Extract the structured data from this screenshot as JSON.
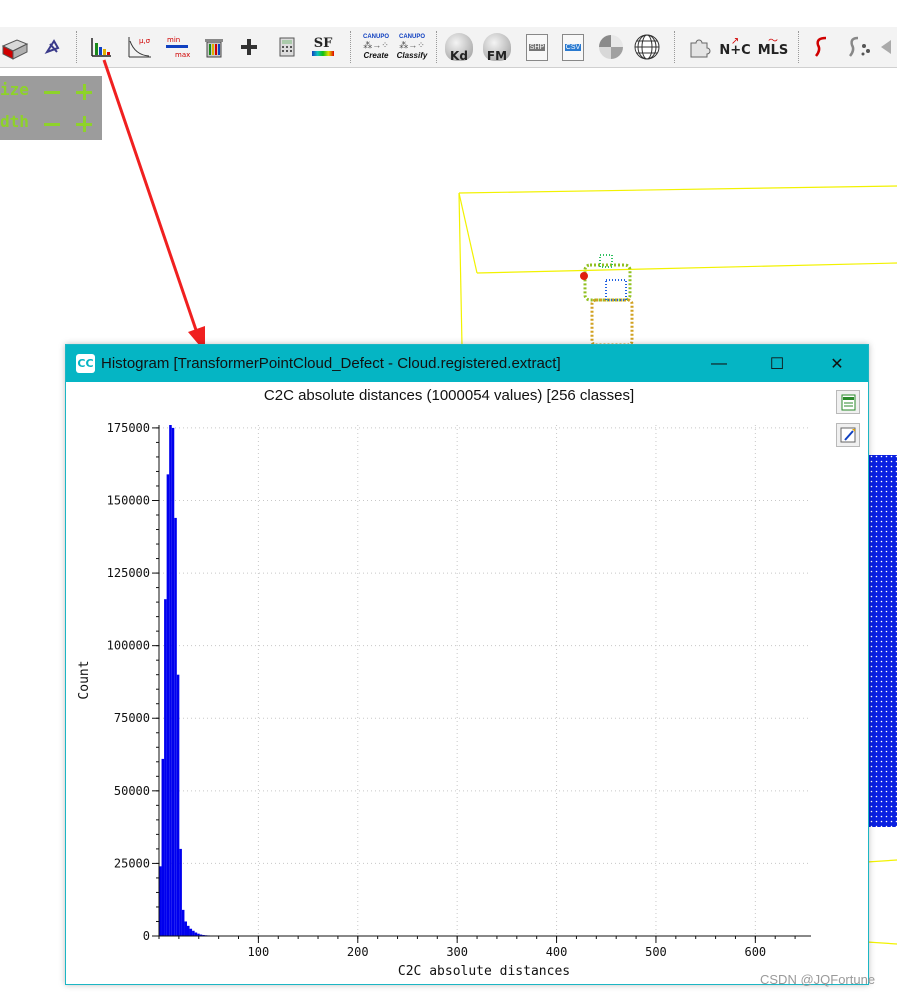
{
  "toolbar": {
    "labels": {
      "sf": "SF",
      "canupo_create_top": "CANUPO",
      "canupo_create_bottom": "Create",
      "canupo_classify_top": "CANUPO",
      "canupo_classify_bottom": "Classify",
      "kd": "Kd",
      "fm": "FM",
      "shp": "SHP",
      "csv": "CSV",
      "nc": "N+C",
      "mls": "MLS",
      "minmax_min": "min",
      "minmax_max": "max",
      "mu_sigma": "µ,σ"
    },
    "icons": [
      "box-icon",
      "pick-icon",
      "histogram-icon",
      "stat-test-icon",
      "min-max-icon",
      "delete-sf-icon",
      "plus-icon",
      "calculator-icon",
      "sf-gradient-icon",
      "canupo-create-icon",
      "canupo-classify-icon",
      "kd-tree-icon",
      "fast-marching-icon",
      "shp-icon",
      "csv-icon",
      "sphere-icon",
      "globe-icon",
      "puzzle-icon",
      "normals-colors-icon",
      "mls-icon",
      "s-curve-icon",
      "s-points-icon",
      "back-arrow-icon"
    ]
  },
  "overlay": {
    "row1_label": "ize",
    "row2_label": "dth"
  },
  "window": {
    "title": "Histogram [TransformerPointCloud_Defect - Cloud.registered.extract]",
    "minimize_glyph": "—",
    "maximize_glyph": "☐",
    "close_glyph": "✕",
    "app_icon_text": "CC",
    "csv_button_icon": "export-csv-icon",
    "image_button_icon": "export-image-icon"
  },
  "chart_data": {
    "type": "bar",
    "title": "C2C absolute distances (1000054 values)  [256 classes]",
    "xlabel": "C2C absolute distances",
    "ylabel": "Count",
    "xlim": [
      0,
      656
    ],
    "ylim": [
      0,
      176000
    ],
    "xticks": [
      100,
      200,
      300,
      400,
      500,
      600
    ],
    "yticks": [
      0,
      25000,
      50000,
      75000,
      100000,
      125000,
      150000,
      175000
    ],
    "grid": true,
    "bar_color": "#0000ee",
    "bin_width": 2.56,
    "bins": [
      {
        "x": 1.28,
        "y": 24000
      },
      {
        "x": 3.84,
        "y": 61000
      },
      {
        "x": 6.4,
        "y": 116000
      },
      {
        "x": 8.96,
        "y": 159000
      },
      {
        "x": 11.52,
        "y": 182000
      },
      {
        "x": 14.08,
        "y": 175000
      },
      {
        "x": 16.64,
        "y": 144000
      },
      {
        "x": 19.2,
        "y": 90000
      },
      {
        "x": 21.76,
        "y": 30000
      },
      {
        "x": 24.32,
        "y": 9000
      },
      {
        "x": 26.88,
        "y": 5000
      },
      {
        "x": 29.44,
        "y": 3500
      },
      {
        "x": 32.0,
        "y": 2500
      },
      {
        "x": 34.56,
        "y": 1800
      },
      {
        "x": 37.12,
        "y": 1200
      },
      {
        "x": 39.68,
        "y": 800
      },
      {
        "x": 42.24,
        "y": 500
      },
      {
        "x": 44.8,
        "y": 350
      },
      {
        "x": 47.36,
        "y": 250
      },
      {
        "x": 49.92,
        "y": 200
      },
      {
        "x": 52.48,
        "y": 150
      },
      {
        "x": 55.04,
        "y": 120
      },
      {
        "x": 57.6,
        "y": 100
      },
      {
        "x": 60.16,
        "y": 80
      },
      {
        "x": 62.72,
        "y": 70
      },
      {
        "x": 65.28,
        "y": 60
      },
      {
        "x": 67.84,
        "y": 50
      },
      {
        "x": 70.4,
        "y": 40
      },
      {
        "x": 72.96,
        "y": 35
      },
      {
        "x": 75.52,
        "y": 30
      },
      {
        "x": 78.08,
        "y": 25
      },
      {
        "x": 80.64,
        "y": 20
      }
    ]
  },
  "watermark": "CSDN @JQFortune"
}
